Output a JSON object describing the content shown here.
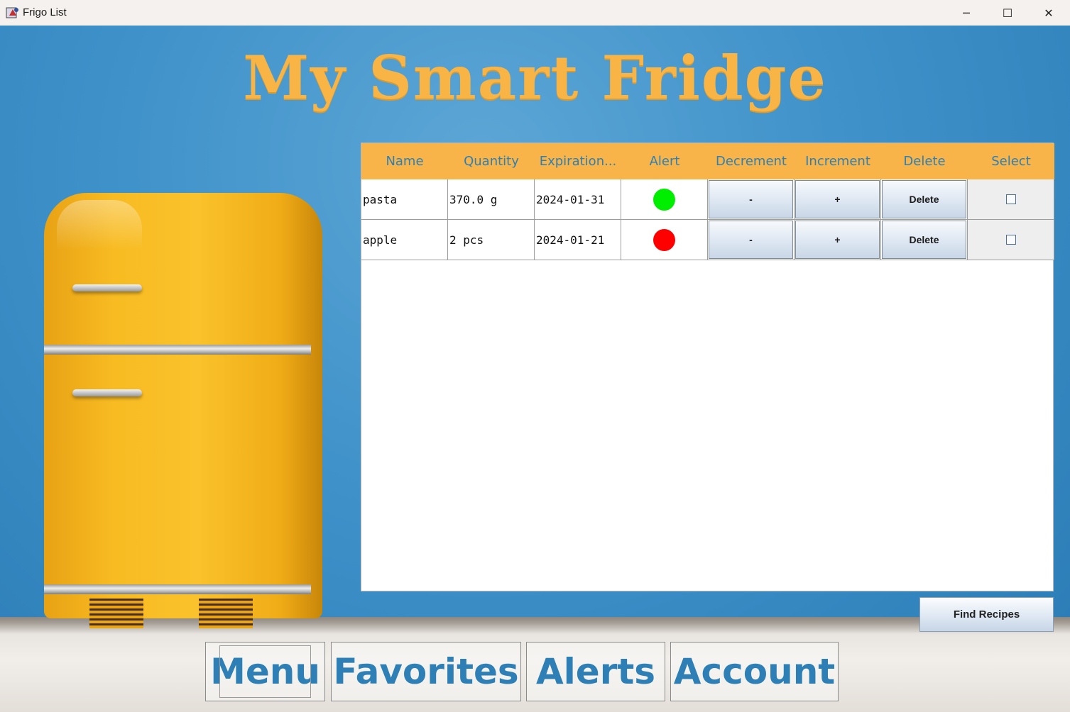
{
  "window": {
    "title": "Frigo List",
    "controls": {
      "minimize": "─",
      "maximize": "☐",
      "close": "✕"
    }
  },
  "heading": "My Smart Fridge",
  "table": {
    "columns": [
      "Name",
      "Quantity",
      "Expiration...",
      "Alert",
      "Decrement",
      "Increment",
      "Delete",
      "Select"
    ],
    "rows": [
      {
        "name": "pasta",
        "quantity": "370.0 g",
        "expiration": "2024-01-31",
        "alert_color": "#00ee00",
        "decrement_label": "-",
        "increment_label": "+",
        "delete_label": "Delete",
        "selected": false
      },
      {
        "name": "apple",
        "quantity": "2 pcs",
        "expiration": "2024-01-21",
        "alert_color": "#ff0000",
        "decrement_label": "-",
        "increment_label": "+",
        "delete_label": "Delete",
        "selected": false
      }
    ]
  },
  "find_recipes_label": "Find Recipes",
  "nav": {
    "menu": "Menu",
    "favorites": "Favorites",
    "alerts": "Alerts",
    "account": "Account"
  },
  "colors": {
    "accent_orange": "#f8b449",
    "accent_blue": "#2d7fb5",
    "background_blue": "#3a8cc4"
  }
}
